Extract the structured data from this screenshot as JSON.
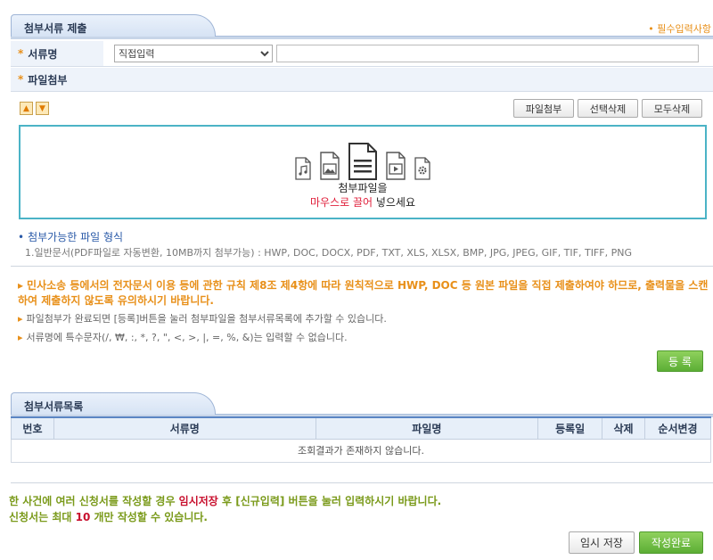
{
  "attach_section": {
    "title": "첨부서류 제출"
  },
  "required_note": {
    "star": "•",
    "text": "필수입력사항"
  },
  "doc_name_row": {
    "label": "서류명",
    "select_value": "직접입력",
    "input_value": ""
  },
  "file_attach_row": {
    "label": "파일첨부"
  },
  "toolbar": {
    "up_arrow": "▲",
    "down_arrow": "▼",
    "attach_label": "파일첨부",
    "delete_selected_label": "선택삭제",
    "delete_all_label": "모두삭제"
  },
  "dropzone": {
    "line1": "첨부파일을",
    "line2_red": "마우스로 끌어",
    "line2_rest": " 넣으세요",
    "icons": [
      "music-file-icon",
      "image-file-icon",
      "document-file-icon",
      "video-file-icon",
      "settings-file-icon"
    ]
  },
  "formats": {
    "title": "첨부가능한 파일 형식",
    "desc": "1.일반문서(PDF파일로 자동변환, 10MB까지 첨부가능) : HWP, DOC, DOCX, PDF, TXT, XLS, XLSX, BMP, JPG, JPEG, GIF, TIF, TIFF, PNG"
  },
  "notices": {
    "warn": "민사소송 등에서의 전자문서 이용 등에 관한 규칙 제8조 제4항에 따라 원칙적으로 HWP, DOC 등 원본 파일을 직접 제출하여야 하므로, 출력물을 스캔하여 제출하지 않도록 유의하시기 바랍니다.",
    "info1": "파일첨부가 완료되면 [등록]버튼을 눌러 첨부파일을 첨부서류목록에 추가할 수 있습니다.",
    "info2": "서류명에 특수문자(/, ₩, :, *, ?, \", <, >, |, =, %, &)는 입력할 수 없습니다."
  },
  "register_button": "등 록",
  "list_section": {
    "title": "첨부서류목록",
    "columns": [
      "번호",
      "서류명",
      "파일명",
      "등록일",
      "삭제",
      "순서변경"
    ],
    "empty_message": "조회결과가 존재하지 않습니다."
  },
  "bottom": {
    "line1_pre": "한 사건에 여러 신청서를 작성할 경우 ",
    "line1_hl": "임시저장",
    "line1_post": " 후 [신규입력] 버튼을 눌러 입력하시기 바랍니다.",
    "line2_pre": "신청서는 최대 ",
    "line2_num": "10",
    "line2_post": " 개만 작성할 수 있습니다.",
    "temp_save_label": "임시 저장",
    "complete_label": "작성완료"
  },
  "colors": {
    "accent_blue": "#5b86c4",
    "orange": "#e8901a",
    "teal_border": "#4bb3c6",
    "green_button": "#5cae35",
    "red_highlight": "#c8102e"
  }
}
